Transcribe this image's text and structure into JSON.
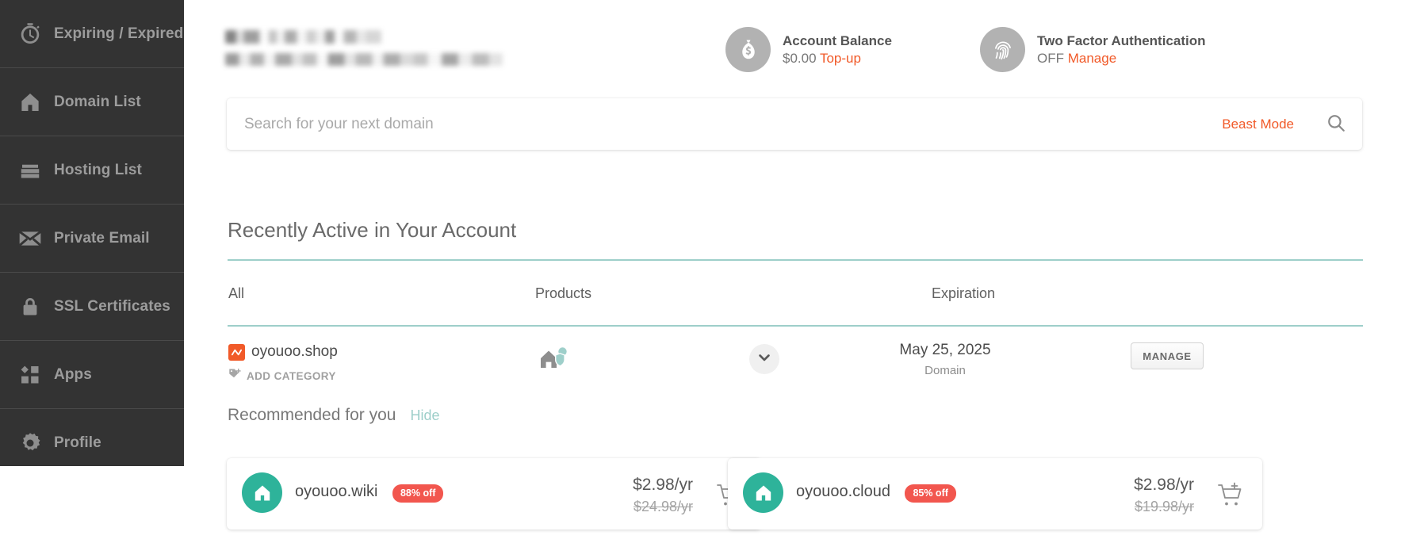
{
  "sidebar": {
    "items": [
      {
        "label": "Expiring / Expired",
        "icon": "stopwatch-icon",
        "key": "expiring-expired"
      },
      {
        "label": "Domain List",
        "icon": "house-icon",
        "key": "domain-list"
      },
      {
        "label": "Hosting List",
        "icon": "server-icon",
        "key": "hosting-list"
      },
      {
        "label": "Private Email",
        "icon": "envelope-icon",
        "key": "private-email"
      },
      {
        "label": "SSL Certificates",
        "icon": "lock-icon",
        "key": "ssl-certificates"
      },
      {
        "label": "Apps",
        "icon": "apps-grid-icon",
        "key": "apps"
      },
      {
        "label": "Profile",
        "icon": "gear-icon",
        "key": "profile"
      }
    ]
  },
  "header": {
    "greeting_redacted": true,
    "balance": {
      "title": "Account Balance",
      "amount": "$0.00",
      "action": "Top-up",
      "icon": "money-bag-icon"
    },
    "two_factor": {
      "title": "Two Factor Authentication",
      "status": "OFF",
      "action": "Manage",
      "icon": "fingerprint-icon"
    }
  },
  "search": {
    "placeholder": "Search for your next domain",
    "value": "",
    "beast_mode": "Beast Mode",
    "icon": "search-icon"
  },
  "recently_active": {
    "title": "Recently Active in Your Account",
    "columns": [
      "All",
      "Products",
      "Expiration"
    ],
    "rows": [
      {
        "domain": "oyouoo.shop",
        "add_category": "ADD CATEGORY",
        "products_icon": "hosting-shield-icon",
        "expiration_date": "May 25, 2025",
        "expiration_type": "Domain",
        "manage_label": "MANAGE"
      }
    ]
  },
  "recommended": {
    "title": "Recommended for you",
    "hide_label": "Hide",
    "cards": [
      {
        "domain": "oyouoo.wiki",
        "discount": "88% off",
        "price": "$2.98/yr",
        "old_price": "$24.98/yr",
        "icon": "house-icon",
        "cart_icon": "cart-plus-icon"
      },
      {
        "domain": "oyouoo.cloud",
        "discount": "85% off",
        "price": "$2.98/yr",
        "old_price": "$19.98/yr",
        "icon": "house-icon",
        "cart_icon": "cart-plus-icon"
      }
    ]
  },
  "colors": {
    "sidebar_bg": "#333333",
    "sidebar_text": "#9c9c9c",
    "accent_red": "#f15a29",
    "accent_teal": "#9ecfca",
    "green_circle": "#2eb39a",
    "badge_red": "#f2564e",
    "domain_badge_orange": "#f15a29"
  }
}
